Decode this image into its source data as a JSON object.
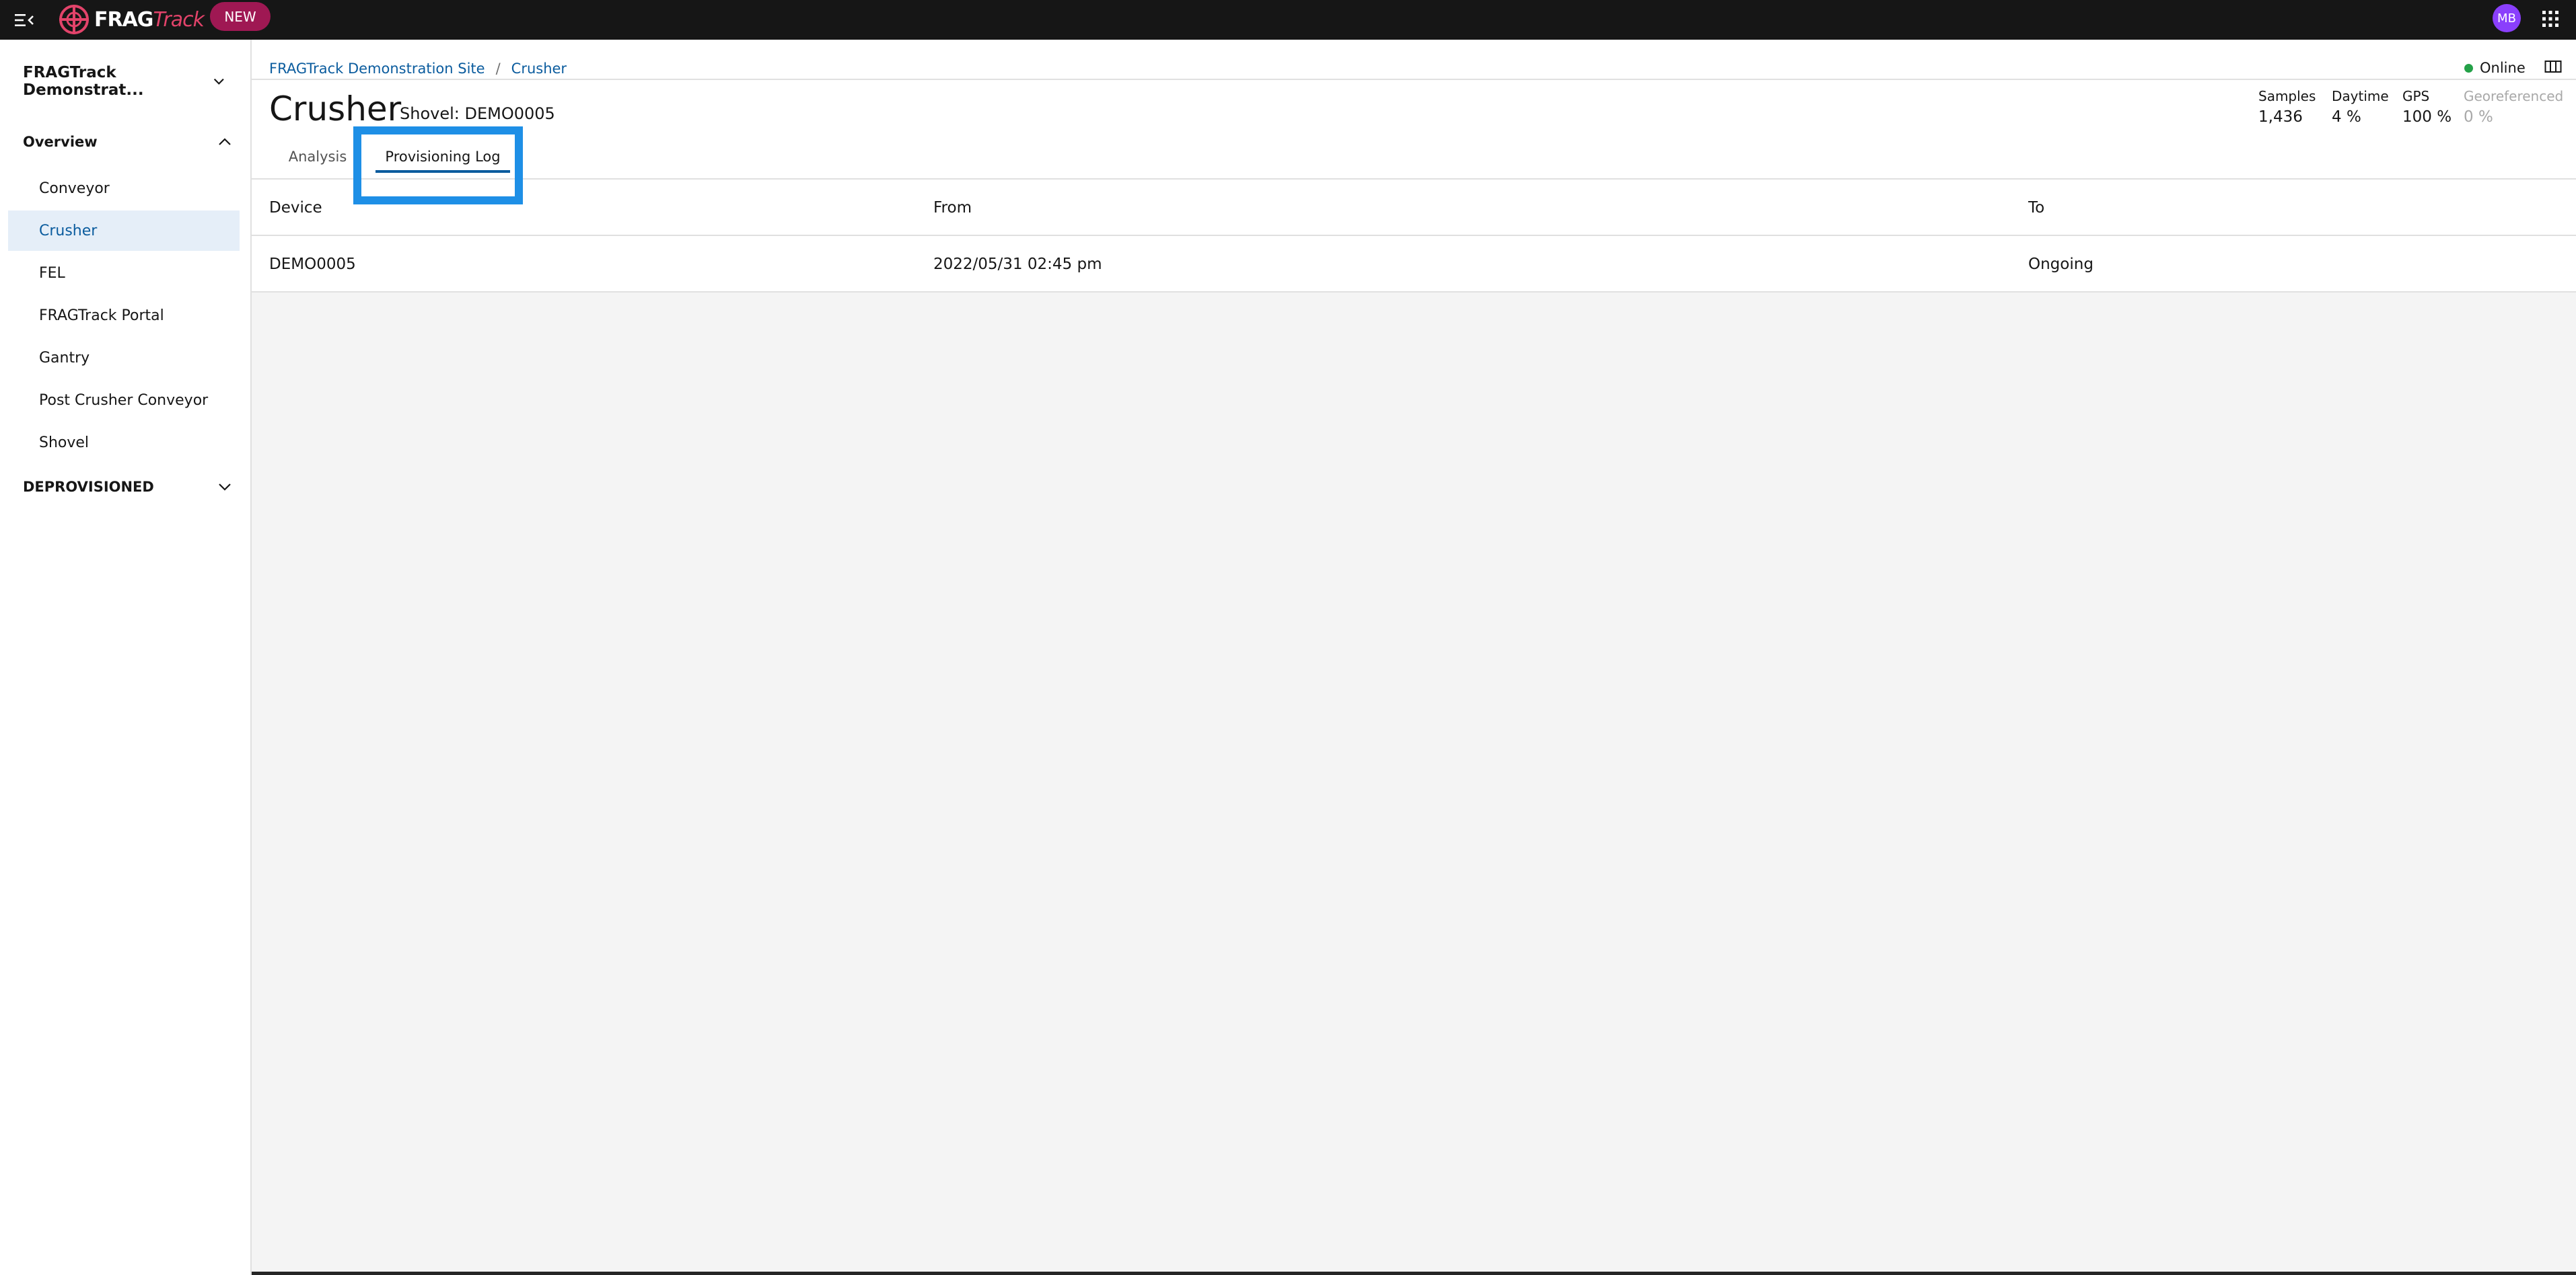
{
  "topbar": {
    "logo_bold": "FRAG",
    "logo_light": "Track",
    "new_badge": "NEW",
    "avatar_initials": "MB"
  },
  "sidebar": {
    "site_selector": "FRAGTrack Demonstrat...",
    "overview_label": "Overview",
    "items": [
      {
        "label": "Conveyor"
      },
      {
        "label": "Crusher"
      },
      {
        "label": "FEL"
      },
      {
        "label": "FRAGTrack Portal"
      },
      {
        "label": "Gantry"
      },
      {
        "label": "Post Crusher Conveyor"
      },
      {
        "label": "Shovel"
      }
    ],
    "active_item": "Crusher",
    "deprovisioned_label": "DEPROVISIONED"
  },
  "header": {
    "breadcrumb": [
      "FRAGTrack Demonstration Site",
      "Crusher"
    ],
    "status": "Online",
    "title": "Crusher",
    "subtitle": "Shovel: DEMO0005",
    "stats": [
      {
        "label": "Samples",
        "value": "1,436"
      },
      {
        "label": "Daytime",
        "value": "4 %"
      },
      {
        "label": "GPS",
        "value": "100 %"
      },
      {
        "label": "Georeferenced",
        "value": "0 %"
      }
    ],
    "tabs": [
      {
        "label": "Analysis"
      },
      {
        "label": "Provisioning Log"
      }
    ],
    "active_tab": "Provisioning Log"
  },
  "table": {
    "columns": [
      "Device",
      "From",
      "To"
    ],
    "rows": [
      [
        "DEMO0005",
        "2022/05/31 02:45 pm",
        "Ongoing"
      ]
    ]
  },
  "colors": {
    "topbar_bg": "#161616",
    "accent": "#0b5c9e",
    "badge": "#9f1853",
    "avatar": "#8a3ffc",
    "online": "#24a148",
    "focus_ring": "#1e8fe6"
  },
  "icons": {
    "menu": "menu-collapse-icon",
    "logo": "crosshair-logo-icon",
    "apps": "app-grid-icon",
    "map": "map-book-icon",
    "chevron": "chevron-icon"
  }
}
